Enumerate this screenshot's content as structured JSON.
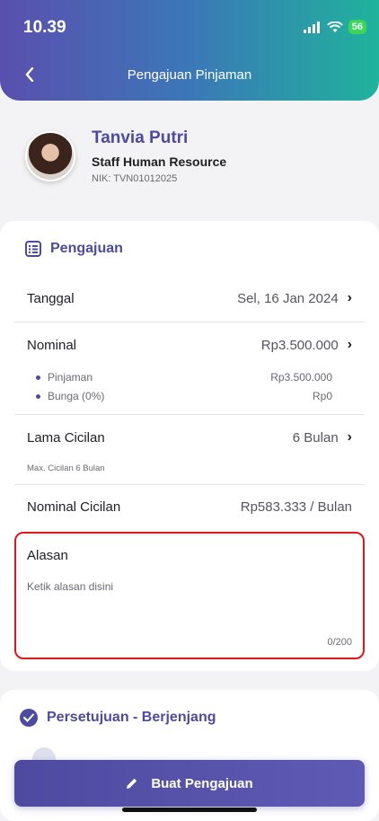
{
  "status": {
    "time": "10.39",
    "battery": "56"
  },
  "header": {
    "title": "Pengajuan Pinjaman"
  },
  "profile": {
    "name": "Tanvia Putri",
    "role": "Staff Human Resource",
    "nik": "NIK: TVN01012025"
  },
  "section": {
    "title": "Pengajuan"
  },
  "fields": {
    "tanggal": {
      "label": "Tanggal",
      "value": "Sel, 16 Jan 2024"
    },
    "nominal": {
      "label": "Nominal",
      "value": "Rp3.500.000"
    },
    "pinjaman": {
      "label": "Pinjaman",
      "value": "Rp3.500.000"
    },
    "bunga": {
      "label": "Bunga (0%)",
      "value": "Rp0"
    },
    "lama_cicilan": {
      "label": "Lama Cicilan",
      "value": "6 Bulan",
      "note": "Max. Cicilan 6 Bulan"
    },
    "nominal_cicilan": {
      "label": "Nominal Cicilan",
      "value": "Rp583.333 / Bulan"
    }
  },
  "reason": {
    "label": "Alasan",
    "placeholder": "Ketik alasan disini",
    "count": "0/200"
  },
  "approval": {
    "title": "Persetujuan - Berjenjang"
  },
  "submit": {
    "label": "Buat Pengajuan"
  },
  "colors": {
    "primary": "#4E4AA0",
    "highlight": "#E0161B",
    "teal": "#1FB39C"
  }
}
